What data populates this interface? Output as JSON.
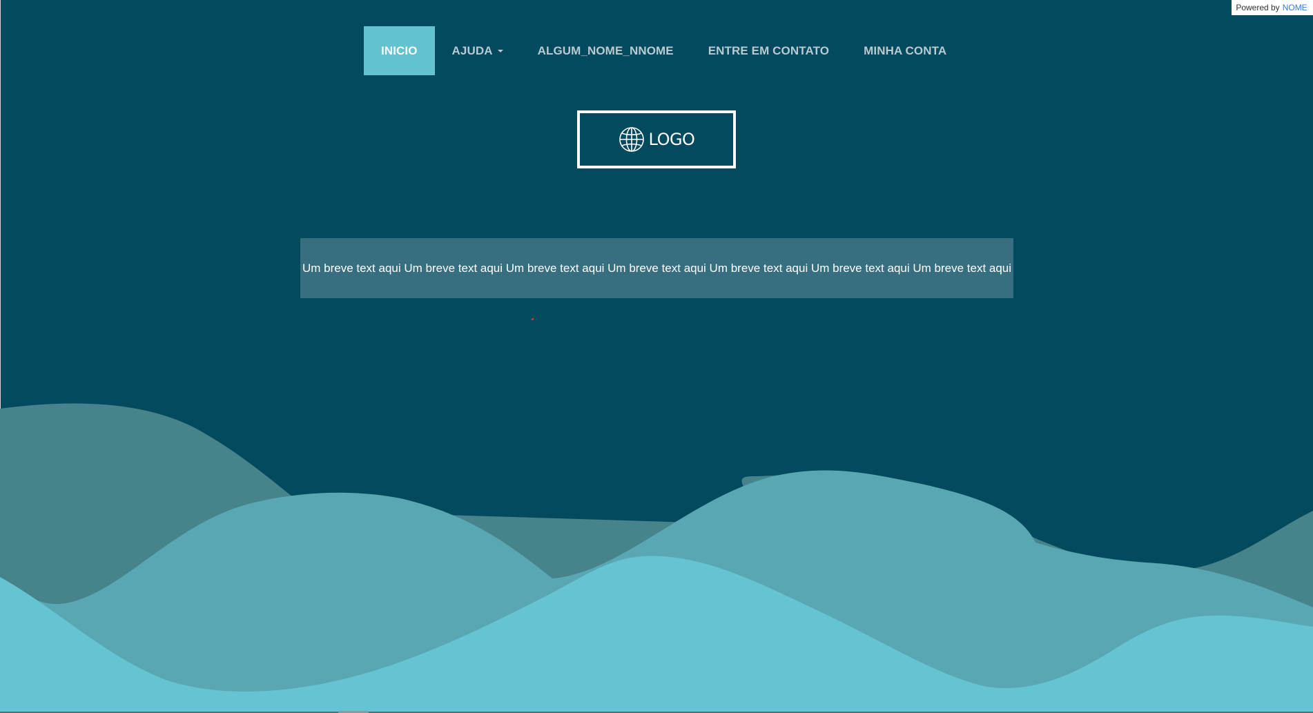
{
  "powered_by": {
    "prefix": "Powered by",
    "brand": "NOME"
  },
  "nav": {
    "items": [
      {
        "label": "INICIO",
        "active": true
      },
      {
        "label": "AJUDA",
        "dropdown": true
      },
      {
        "label": "ALGUM_NOME_NNOME"
      },
      {
        "label": "ENTRE EM CONTATO"
      },
      {
        "label": "MINHA CONTA"
      }
    ]
  },
  "logo": {
    "text": "LOGO",
    "icon": "globe-icon"
  },
  "hero": {
    "text": "Um breve text aqui Um breve text aqui Um breve text aqui Um breve text aqui Um breve text aqui Um breve text aqui Um breve text aqui"
  },
  "colors": {
    "background": "#034a5f",
    "nav_active": "#62c2cf",
    "nav_text": "#b9cbd1",
    "text_box": "#386f80",
    "wave_far": "#46838b",
    "wave_mid": "#59a7b2",
    "wave_near": "#66c3d1"
  }
}
